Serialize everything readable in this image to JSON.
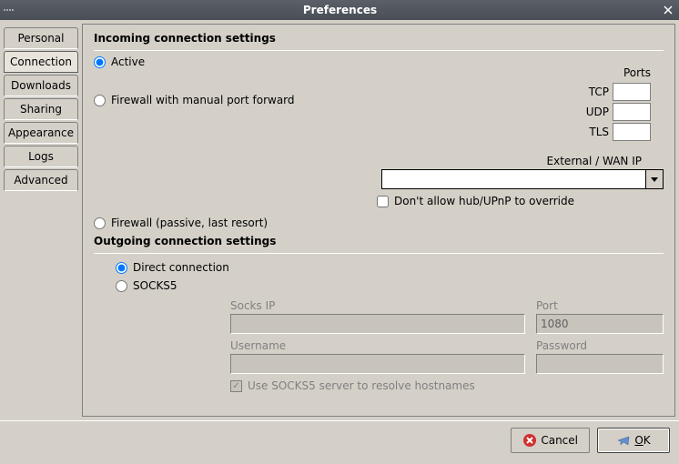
{
  "window": {
    "title": "Preferences"
  },
  "sidebar": {
    "tabs": [
      {
        "label": "Personal"
      },
      {
        "label": "Connection"
      },
      {
        "label": "Downloads"
      },
      {
        "label": "Sharing"
      },
      {
        "label": "Appearance"
      },
      {
        "label": "Logs"
      },
      {
        "label": "Advanced"
      }
    ],
    "active_index": 1
  },
  "incoming": {
    "group_title": "Incoming connection settings",
    "radio_active": "Active",
    "radio_firewall_forward": "Firewall with manual port forward",
    "radio_firewall_passive": "Firewall (passive, last resort)",
    "selected": "active",
    "ports_title": "Ports",
    "tcp_label": "TCP",
    "udp_label": "UDP",
    "tls_label": "TLS",
    "tcp_value": "",
    "udp_value": "",
    "tls_value": "",
    "ext_wan_label": "External / WAN IP",
    "ext_wan_value": "",
    "override_label": "Don't allow hub/UPnP to override",
    "override_checked": false
  },
  "outgoing": {
    "group_title": "Outgoing connection settings",
    "radio_direct": "Direct connection",
    "radio_socks": "SOCKS5",
    "selected": "direct",
    "socks_ip_label": "Socks IP",
    "socks_ip_value": "",
    "port_label": "Port",
    "port_value": "1080",
    "username_label": "Username",
    "username_value": "",
    "password_label": "Password",
    "password_value": "",
    "resolve_label": "Use SOCKS5 server to resolve hostnames",
    "resolve_checked": true
  },
  "footer": {
    "cancel": "Cancel",
    "ok": "OK"
  }
}
